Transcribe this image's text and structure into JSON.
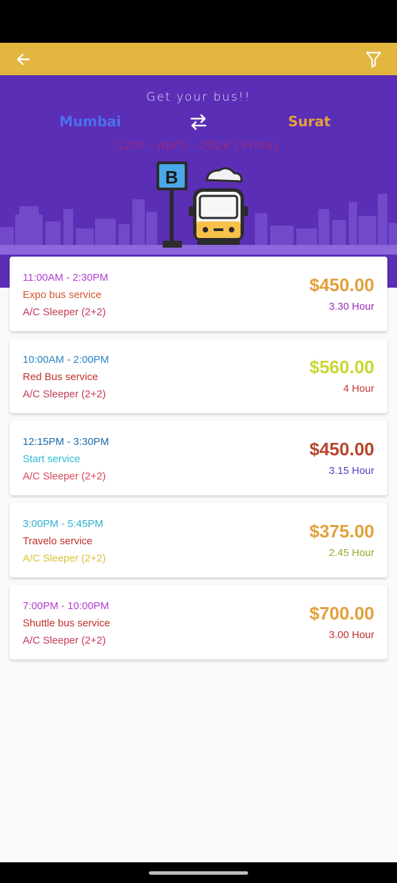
{
  "app_bar": {
    "back_icon": "arrow-left-icon",
    "filter_icon": "filter-icon",
    "color": "#e2b63f"
  },
  "hero": {
    "tagline": "Get your bus!!",
    "from_city": "Mumbai",
    "to_city": "Surat",
    "swap_icon": "swap-arrows-icon",
    "date": "12th - April - 2024 | Friday",
    "background": "#5b2eb6"
  },
  "buses": [
    {
      "time": "11:00AM - 2:30PM",
      "name": "Expo bus service",
      "type": "A/C Sleeper (2+2)",
      "price": "$450.00",
      "duration": "3.30 Hour",
      "colors": {
        "time": "#b23ccf",
        "name": "#d0562a",
        "type": "#c23a55",
        "price": "#e2a03a",
        "duration": "#9b2bbd"
      }
    },
    {
      "time": "10:00AM - 2:00PM",
      "name": "Red Bus service",
      "type": "A/C Sleeper (2+2)",
      "price": "$560.00",
      "duration": "4 Hour",
      "colors": {
        "time": "#2a83c4",
        "name": "#c0302a",
        "type": "#c23a55",
        "price": "#c9d633",
        "duration": "#c23a35"
      }
    },
    {
      "time": "12:15PM - 3:30PM",
      "name": "Start service",
      "type": "A/C Sleeper (2+2)",
      "price": "$450.00",
      "duration": "3.15 Hour",
      "colors": {
        "time": "#1c6aa8",
        "name": "#2bbbd4",
        "type": "#d8485a",
        "price": "#b8442a",
        "duration": "#5a3ac0"
      }
    },
    {
      "time": "3:00PM - 5:45PM",
      "name": "Travelo service",
      "type": "A/C Sleeper (2+2)",
      "price": "$375.00",
      "duration": "2.45 Hour",
      "colors": {
        "time": "#2bb0d0",
        "name": "#c0302a",
        "type": "#d9c23a",
        "price": "#e2a03a",
        "duration": "#9aa82a"
      }
    },
    {
      "time": "7:00PM - 10:00PM",
      "name": "Shuttle bus service",
      "type": "A/C Sleeper (2+2)",
      "price": "$700.00",
      "duration": "3.00 Hour",
      "colors": {
        "time": "#b23ccf",
        "name": "#c0302a",
        "type": "#c23a55",
        "price": "#e2a03a",
        "duration": "#c0302a"
      }
    }
  ]
}
